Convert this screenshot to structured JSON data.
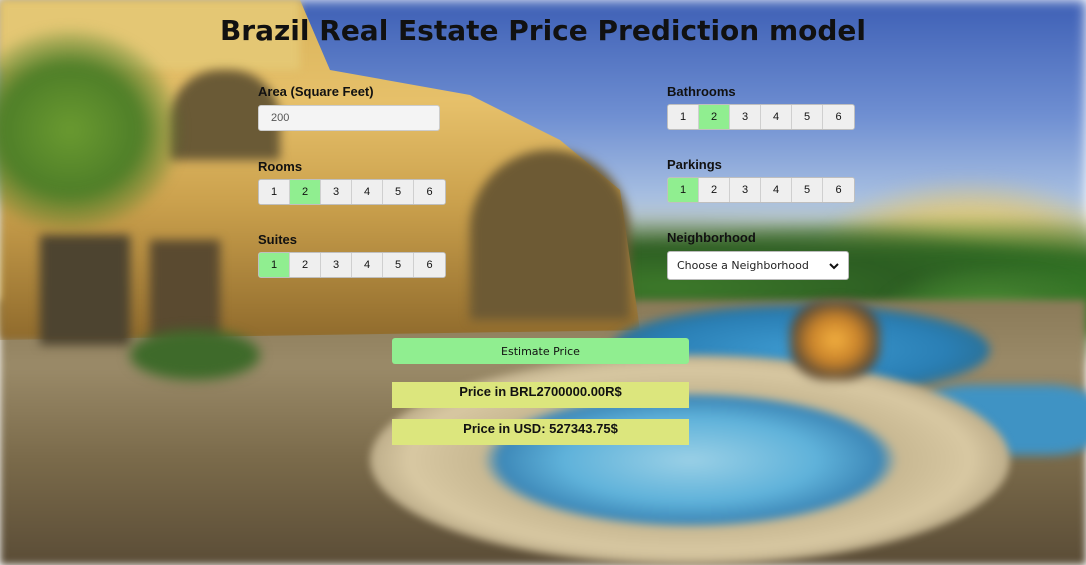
{
  "title": "Brazil Real Estate Price Prediction model",
  "area": {
    "label": "Area (Square Feet)",
    "value": "200"
  },
  "rooms": {
    "label": "Rooms",
    "options": [
      "1",
      "2",
      "3",
      "4",
      "5",
      "6"
    ],
    "selected": "2"
  },
  "suites": {
    "label": "Suites",
    "options": [
      "1",
      "2",
      "3",
      "4",
      "5",
      "6"
    ],
    "selected": "1"
  },
  "bathrooms": {
    "label": "Bathrooms",
    "options": [
      "1",
      "2",
      "3",
      "4",
      "5",
      "6"
    ],
    "selected": "2"
  },
  "parkings": {
    "label": "Parkings",
    "options": [
      "1",
      "2",
      "3",
      "4",
      "5",
      "6"
    ],
    "selected": "1"
  },
  "neighborhood": {
    "label": "Neighborhood",
    "selected": "Choose a Neighborhood"
  },
  "estimate_button": "Estimate Price",
  "results": {
    "brl": "Price in BRL2700000.00R$",
    "usd": "Price in USD: 527343.75$"
  },
  "colors": {
    "selected": "#90ee90",
    "result_bg": "#dce67d",
    "button_bg": "#90ee90"
  },
  "icons": {
    "select_arrow": "chevron-down-icon"
  }
}
